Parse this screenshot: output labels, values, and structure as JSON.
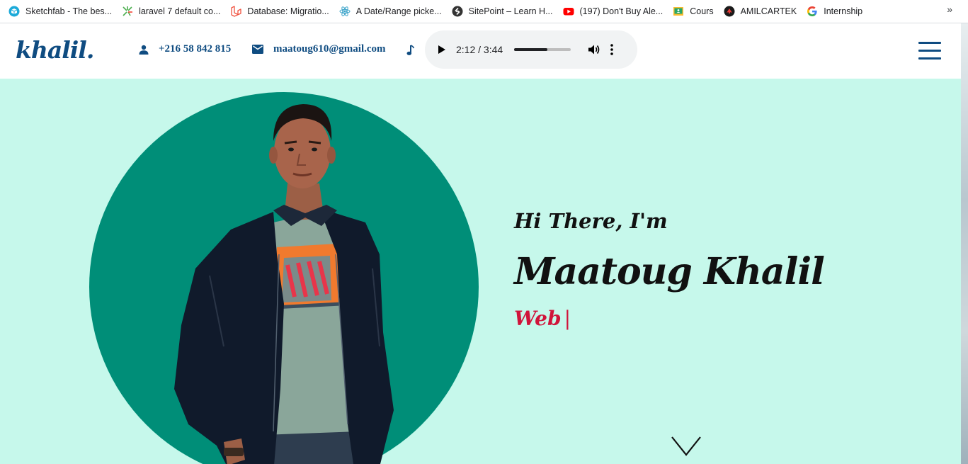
{
  "bookmarks": [
    {
      "label": "Sketchfab - The bes...",
      "icon": "sketchfab-icon"
    },
    {
      "label": "laravel 7 default co...",
      "icon": "laravel-sparkle-icon"
    },
    {
      "label": "Database: Migratio...",
      "icon": "laravel-icon"
    },
    {
      "label": "A Date/Range picke...",
      "icon": "react-icon"
    },
    {
      "label": "SitePoint – Learn H...",
      "icon": "sitepoint-icon"
    },
    {
      "label": "(197) Don't Buy Ale...",
      "icon": "youtube-icon"
    },
    {
      "label": "Cours",
      "icon": "classroom-icon"
    },
    {
      "label": "AMILCARTEK",
      "icon": "amilcartek-icon"
    },
    {
      "label": "Internship",
      "icon": "google-icon"
    }
  ],
  "bookmarks_more": "»",
  "header": {
    "logo": "khalil.",
    "phone": "+216 58 842 815",
    "email": "maatoug610@gmail.com",
    "audio": {
      "current": "2:12",
      "total": "3:44",
      "time_label": "2:12 / 3:44",
      "progress_fraction": 0.59
    }
  },
  "hero": {
    "greeting": "Hi There, I'm",
    "name": "Maatoug Khalil",
    "role": "Web",
    "cursor": "|"
  },
  "colors": {
    "brand": "#0f4c81",
    "hero_bg": "#c6f8eb",
    "circle": "#008e78",
    "accent": "#d0143a",
    "text": "#111111"
  }
}
